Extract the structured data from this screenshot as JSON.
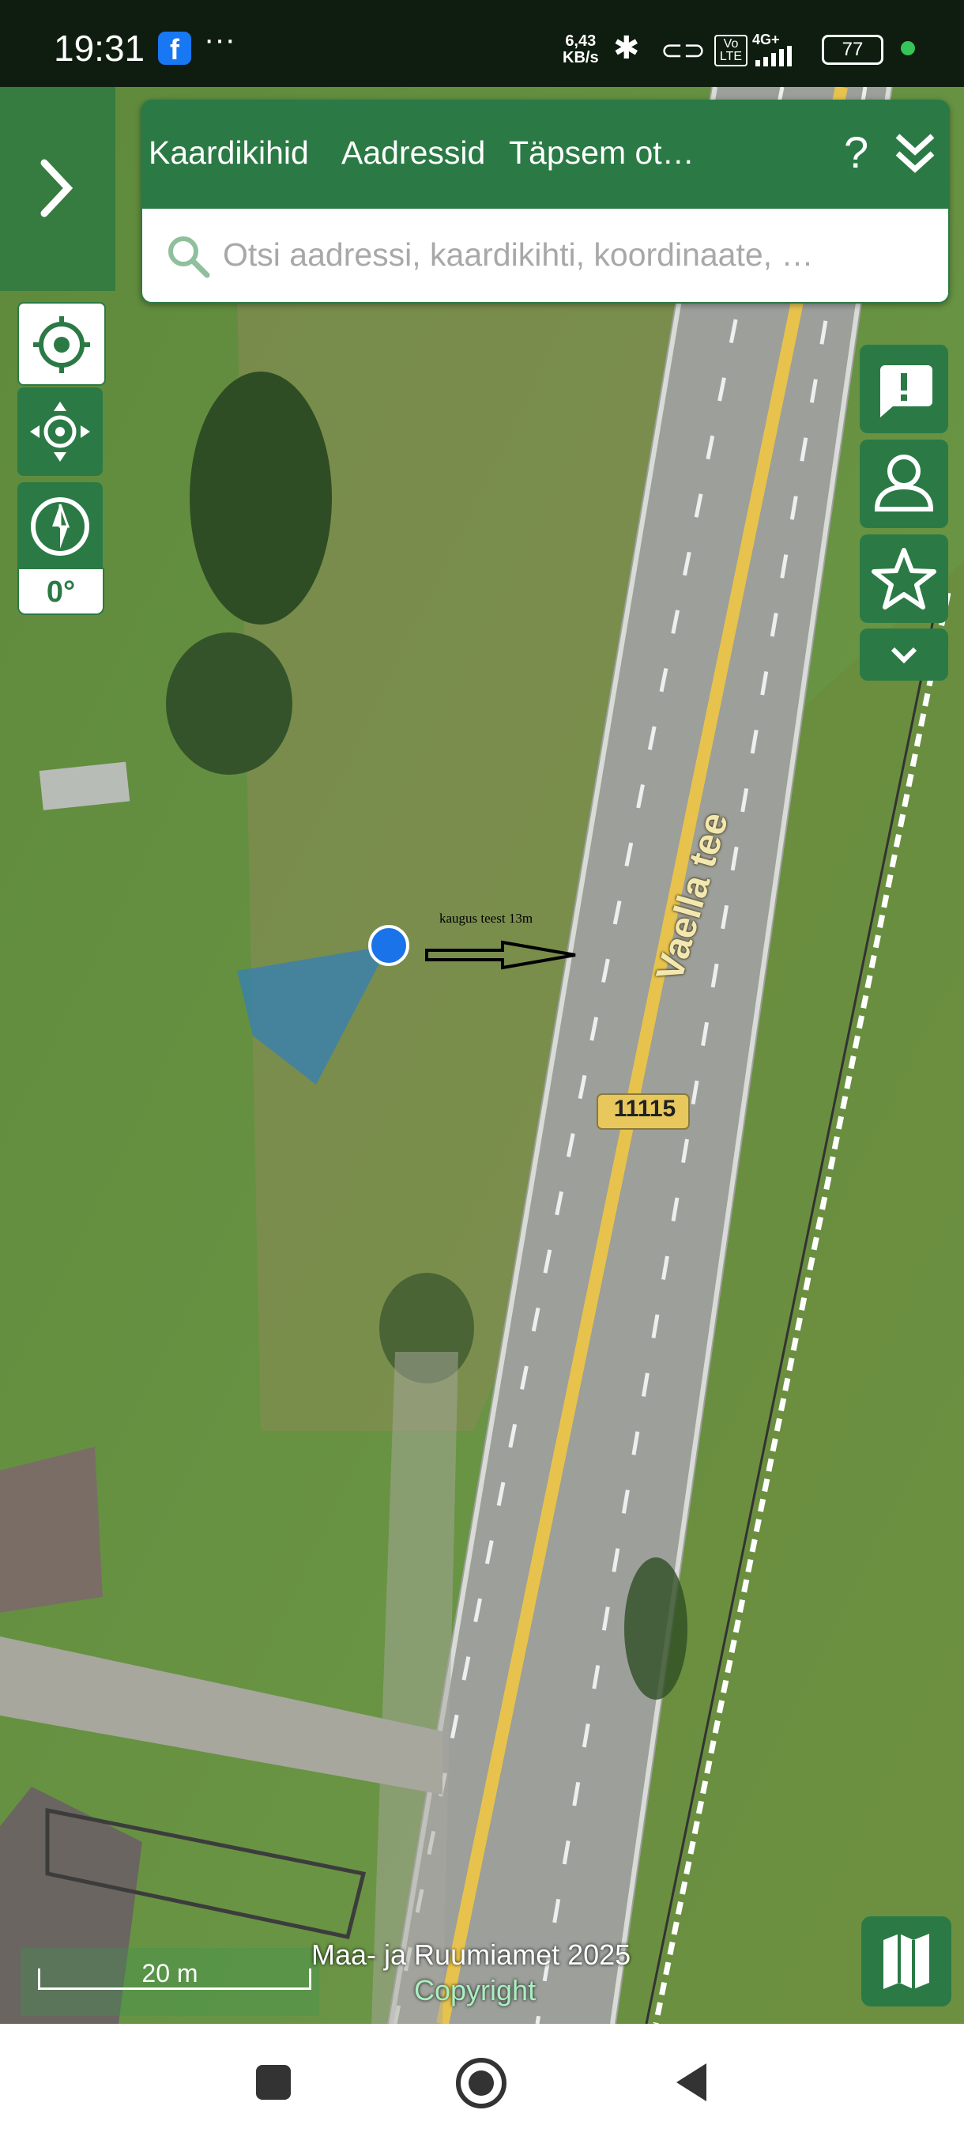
{
  "status_bar": {
    "time": "19:31",
    "app_icon": "facebook-icon",
    "more": "···",
    "net_speed_value": "6,43",
    "net_speed_unit": "KB/s",
    "network_label": "4G+",
    "volte_label": "Vo LTE",
    "battery_level": "77"
  },
  "panel": {
    "tabs": [
      {
        "label": "Kaardikihid"
      },
      {
        "label": "Aadressid"
      },
      {
        "label": "Täpsem ot…"
      }
    ],
    "help_label": "?",
    "collapse_icon": "double-chevron-down-icon",
    "search_placeholder": "Otsi aadressi, kaardikihti, koordinaate, …"
  },
  "map_controls": {
    "rotation_value": "0°",
    "buttons": [
      "locate-icon",
      "move-crosshair-icon",
      "compass-icon"
    ]
  },
  "right_controls": [
    "feedback-icon",
    "user-icon",
    "star-icon",
    "chevron-down-icon"
  ],
  "map": {
    "road_name": "Vaella tee",
    "road_number": "11115",
    "distance_note": "kaugus teest 13m"
  },
  "scale": {
    "label": "20 m"
  },
  "attribution": {
    "text": "Maa- ja Ruumiamet 2025",
    "copyright": "Copyright"
  },
  "colors": {
    "brand_green": "#2b7a45",
    "location_blue": "#1a73e8",
    "road_yellow": "#e7c34d"
  }
}
